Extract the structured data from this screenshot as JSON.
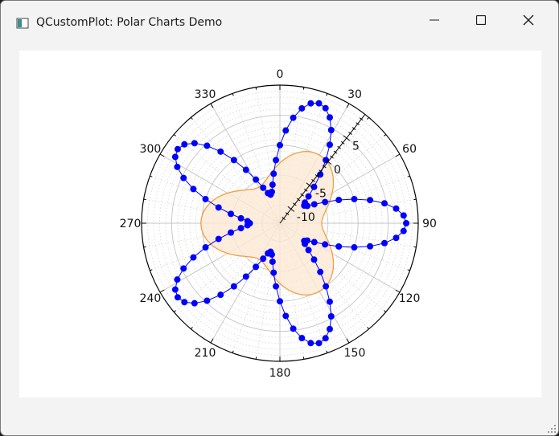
{
  "window": {
    "title": "QCustomPlot: Polar Charts Demo",
    "app_icon": "app-window-icon"
  },
  "controls": {
    "minimize": "minimize-icon",
    "maximize": "maximize-icon",
    "close": "close-icon"
  },
  "colors": {
    "dots": "#0000ff",
    "dot_fill": "#3322cc",
    "area_stroke": "#f0a040",
    "area_fill": "#fde8d3"
  },
  "chart_data": {
    "type": "polar",
    "angular_ticks": [
      "0",
      "30",
      "60",
      "90",
      "120",
      "150",
      "180",
      "210",
      "240",
      "270",
      "300",
      "330"
    ],
    "radial_ticks": [
      "-10",
      "-5",
      "0",
      "5"
    ],
    "radial_range": [
      -13,
      10
    ],
    "series": [
      {
        "type": "line-with-markers",
        "formula": "r(theta) = 8 * sin(5*theta) (theta = 0..360)",
        "points": 100
      },
      {
        "type": "filled-area",
        "formula": "r(theta) = 0.65 + 0.2 * sin(3*theta) (theta = 0..360, normalized)"
      }
    ]
  }
}
